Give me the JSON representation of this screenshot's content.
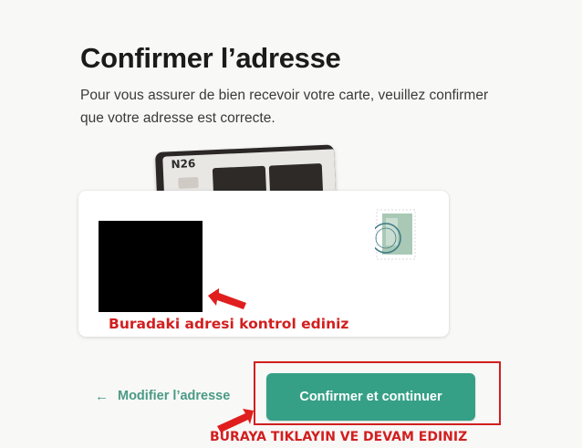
{
  "header": {
    "title": "Confirmer l’adresse",
    "description": "Pour vous assurer de bien recevoir votre carte, veuillez confirmer que votre adresse est correcte."
  },
  "card": {
    "logo_text": "N26"
  },
  "envelope": {
    "annotation": "Buradaki adresi kontrol ediniz"
  },
  "actions": {
    "back_label": "Modifier l’adresse",
    "back_icon": "arrow-left-icon",
    "confirm_label": "Confirmer et continuer",
    "annotation": "BURAYA TIKLAYIN VE DEVAM EDINIZ"
  },
  "colors": {
    "accent": "#35a086",
    "link": "#4a9a86",
    "annotation_red": "#d21f1f"
  }
}
